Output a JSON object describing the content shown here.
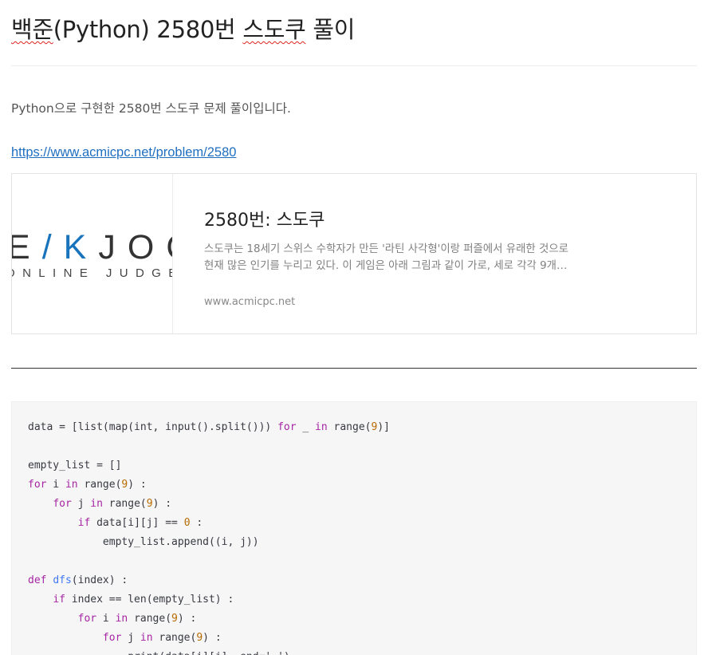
{
  "post": {
    "title_part1": "백준",
    "title_part2": "(Python) 2580번 ",
    "title_part3": "스도쿠",
    "title_part4": " 풀이",
    "intro": "Python으로 구현한 2580번 스도쿠 문제 풀이입니다.",
    "link": "https://www.acmicpc.net/problem/2580"
  },
  "card": {
    "logo_left": "E",
    "logo_accent": "/K",
    "logo_right": "JOC",
    "logo_sub": "ONLINE JUDGE",
    "title": "2580번: 스도쿠",
    "desc_line1": "스도쿠는 18세기 스위스 수학자가 만든 '라틴 사각형'이랑 퍼즐에서 유래한 것으로",
    "desc_line2": "현재 많은 인기를 누리고 있다. 이 게임은 아래 그림과 같이 가로, 세로 각각 9개…",
    "domain": "www.acmicpc.net"
  },
  "code": {
    "lines": [
      [
        {
          "t": "data = [list(map(int, input().split())) "
        },
        {
          "t": "for",
          "c": "kw"
        },
        {
          "t": " _ "
        },
        {
          "t": "in",
          "c": "kw"
        },
        {
          "t": " range("
        },
        {
          "t": "9",
          "c": "num"
        },
        {
          "t": ")]"
        }
      ],
      [
        {
          "t": ""
        }
      ],
      [
        {
          "t": "empty_list = []"
        }
      ],
      [
        {
          "t": "for",
          "c": "kw"
        },
        {
          "t": " i "
        },
        {
          "t": "in",
          "c": "kw"
        },
        {
          "t": " range("
        },
        {
          "t": "9",
          "c": "num"
        },
        {
          "t": ") :"
        }
      ],
      [
        {
          "t": "    "
        },
        {
          "t": "for",
          "c": "kw"
        },
        {
          "t": " j "
        },
        {
          "t": "in",
          "c": "kw"
        },
        {
          "t": " range("
        },
        {
          "t": "9",
          "c": "num"
        },
        {
          "t": ") :"
        }
      ],
      [
        {
          "t": "        "
        },
        {
          "t": "if",
          "c": "kw"
        },
        {
          "t": " data[i][j] == "
        },
        {
          "t": "0",
          "c": "num"
        },
        {
          "t": " :"
        }
      ],
      [
        {
          "t": "            empty_list.append((i, j))"
        }
      ],
      [
        {
          "t": ""
        }
      ],
      [
        {
          "t": "def",
          "c": "kw"
        },
        {
          "t": " "
        },
        {
          "t": "dfs",
          "c": "fn"
        },
        {
          "t": "(index) :"
        }
      ],
      [
        {
          "t": "    "
        },
        {
          "t": "if",
          "c": "kw"
        },
        {
          "t": " index == len(empty_list) :"
        }
      ],
      [
        {
          "t": "        "
        },
        {
          "t": "for",
          "c": "kw"
        },
        {
          "t": " i "
        },
        {
          "t": "in",
          "c": "kw"
        },
        {
          "t": " range("
        },
        {
          "t": "9",
          "c": "num"
        },
        {
          "t": ") :"
        }
      ],
      [
        {
          "t": "            "
        },
        {
          "t": "for",
          "c": "kw"
        },
        {
          "t": " j "
        },
        {
          "t": "in",
          "c": "kw"
        },
        {
          "t": " range("
        },
        {
          "t": "9",
          "c": "num"
        },
        {
          "t": ") :"
        }
      ],
      [
        {
          "t": "                print(data[i][j], end=' ')"
        }
      ]
    ]
  }
}
